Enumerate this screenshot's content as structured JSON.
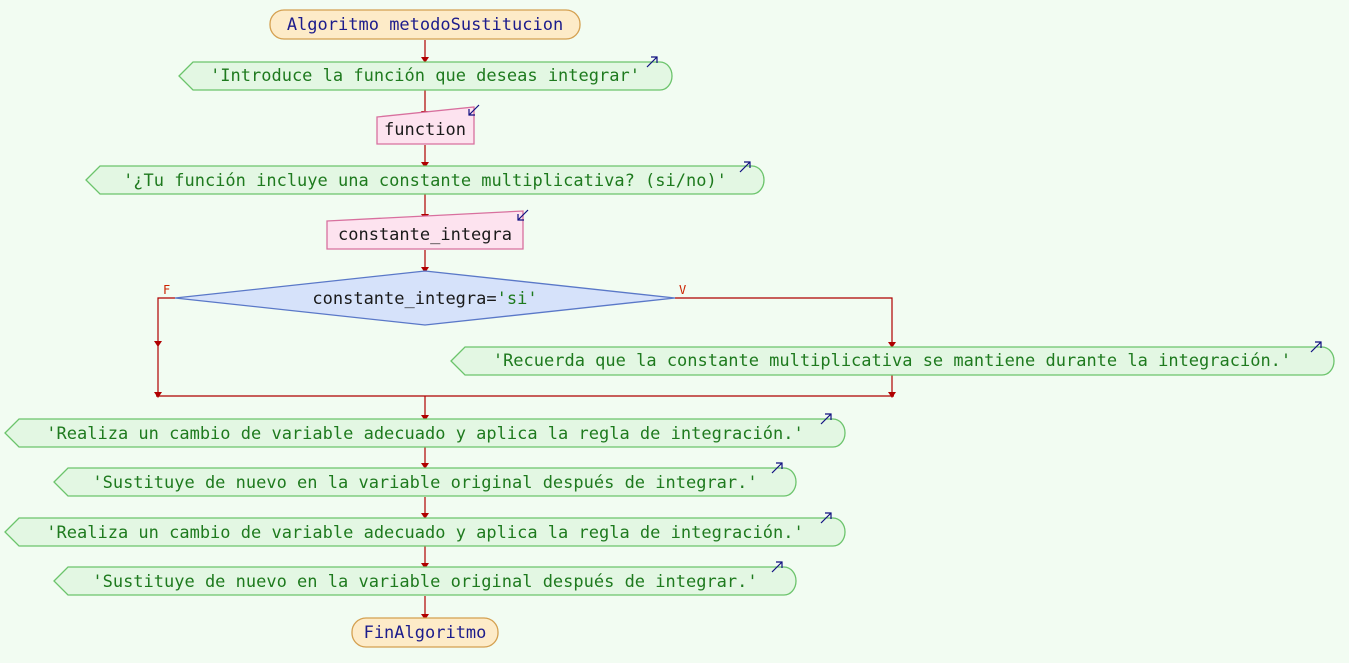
{
  "start": {
    "keyword": "Algoritmo",
    "name": "metodoSustitucion"
  },
  "end": {
    "label": "FinAlgoritmo"
  },
  "outputs": [
    "'Introduce la función que deseas integrar'",
    "'¿Tu función incluye una constante multiplicativa? (si/no)'",
    "'Recuerda que la constante multiplicativa se mantiene durante la integración.'",
    "'Realiza un cambio de variable adecuado y aplica la regla de integración.'",
    "'Sustituye de nuevo en la variable original después de integrar.'",
    "'Realiza un cambio de variable adecuado y aplica la regla de integración.'",
    "'Sustituye de nuevo en la variable original después de integrar.'"
  ],
  "inputs": [
    "function",
    "constante_integra"
  ],
  "decision": {
    "variable": "constante_integra",
    "operator": "=",
    "value": "'si'",
    "false_label": "F",
    "true_label": "V"
  },
  "colors": {
    "terminal_fill": "#fdebc8",
    "terminal_stroke": "#d4a050",
    "output_fill": "#e3f7e3",
    "output_stroke": "#6cc46c",
    "input_fill": "#fde3ef",
    "input_stroke": "#d8709e",
    "decision_fill": "#d6e2fa",
    "decision_stroke": "#5a78c8",
    "flow_line": "#b00000"
  }
}
